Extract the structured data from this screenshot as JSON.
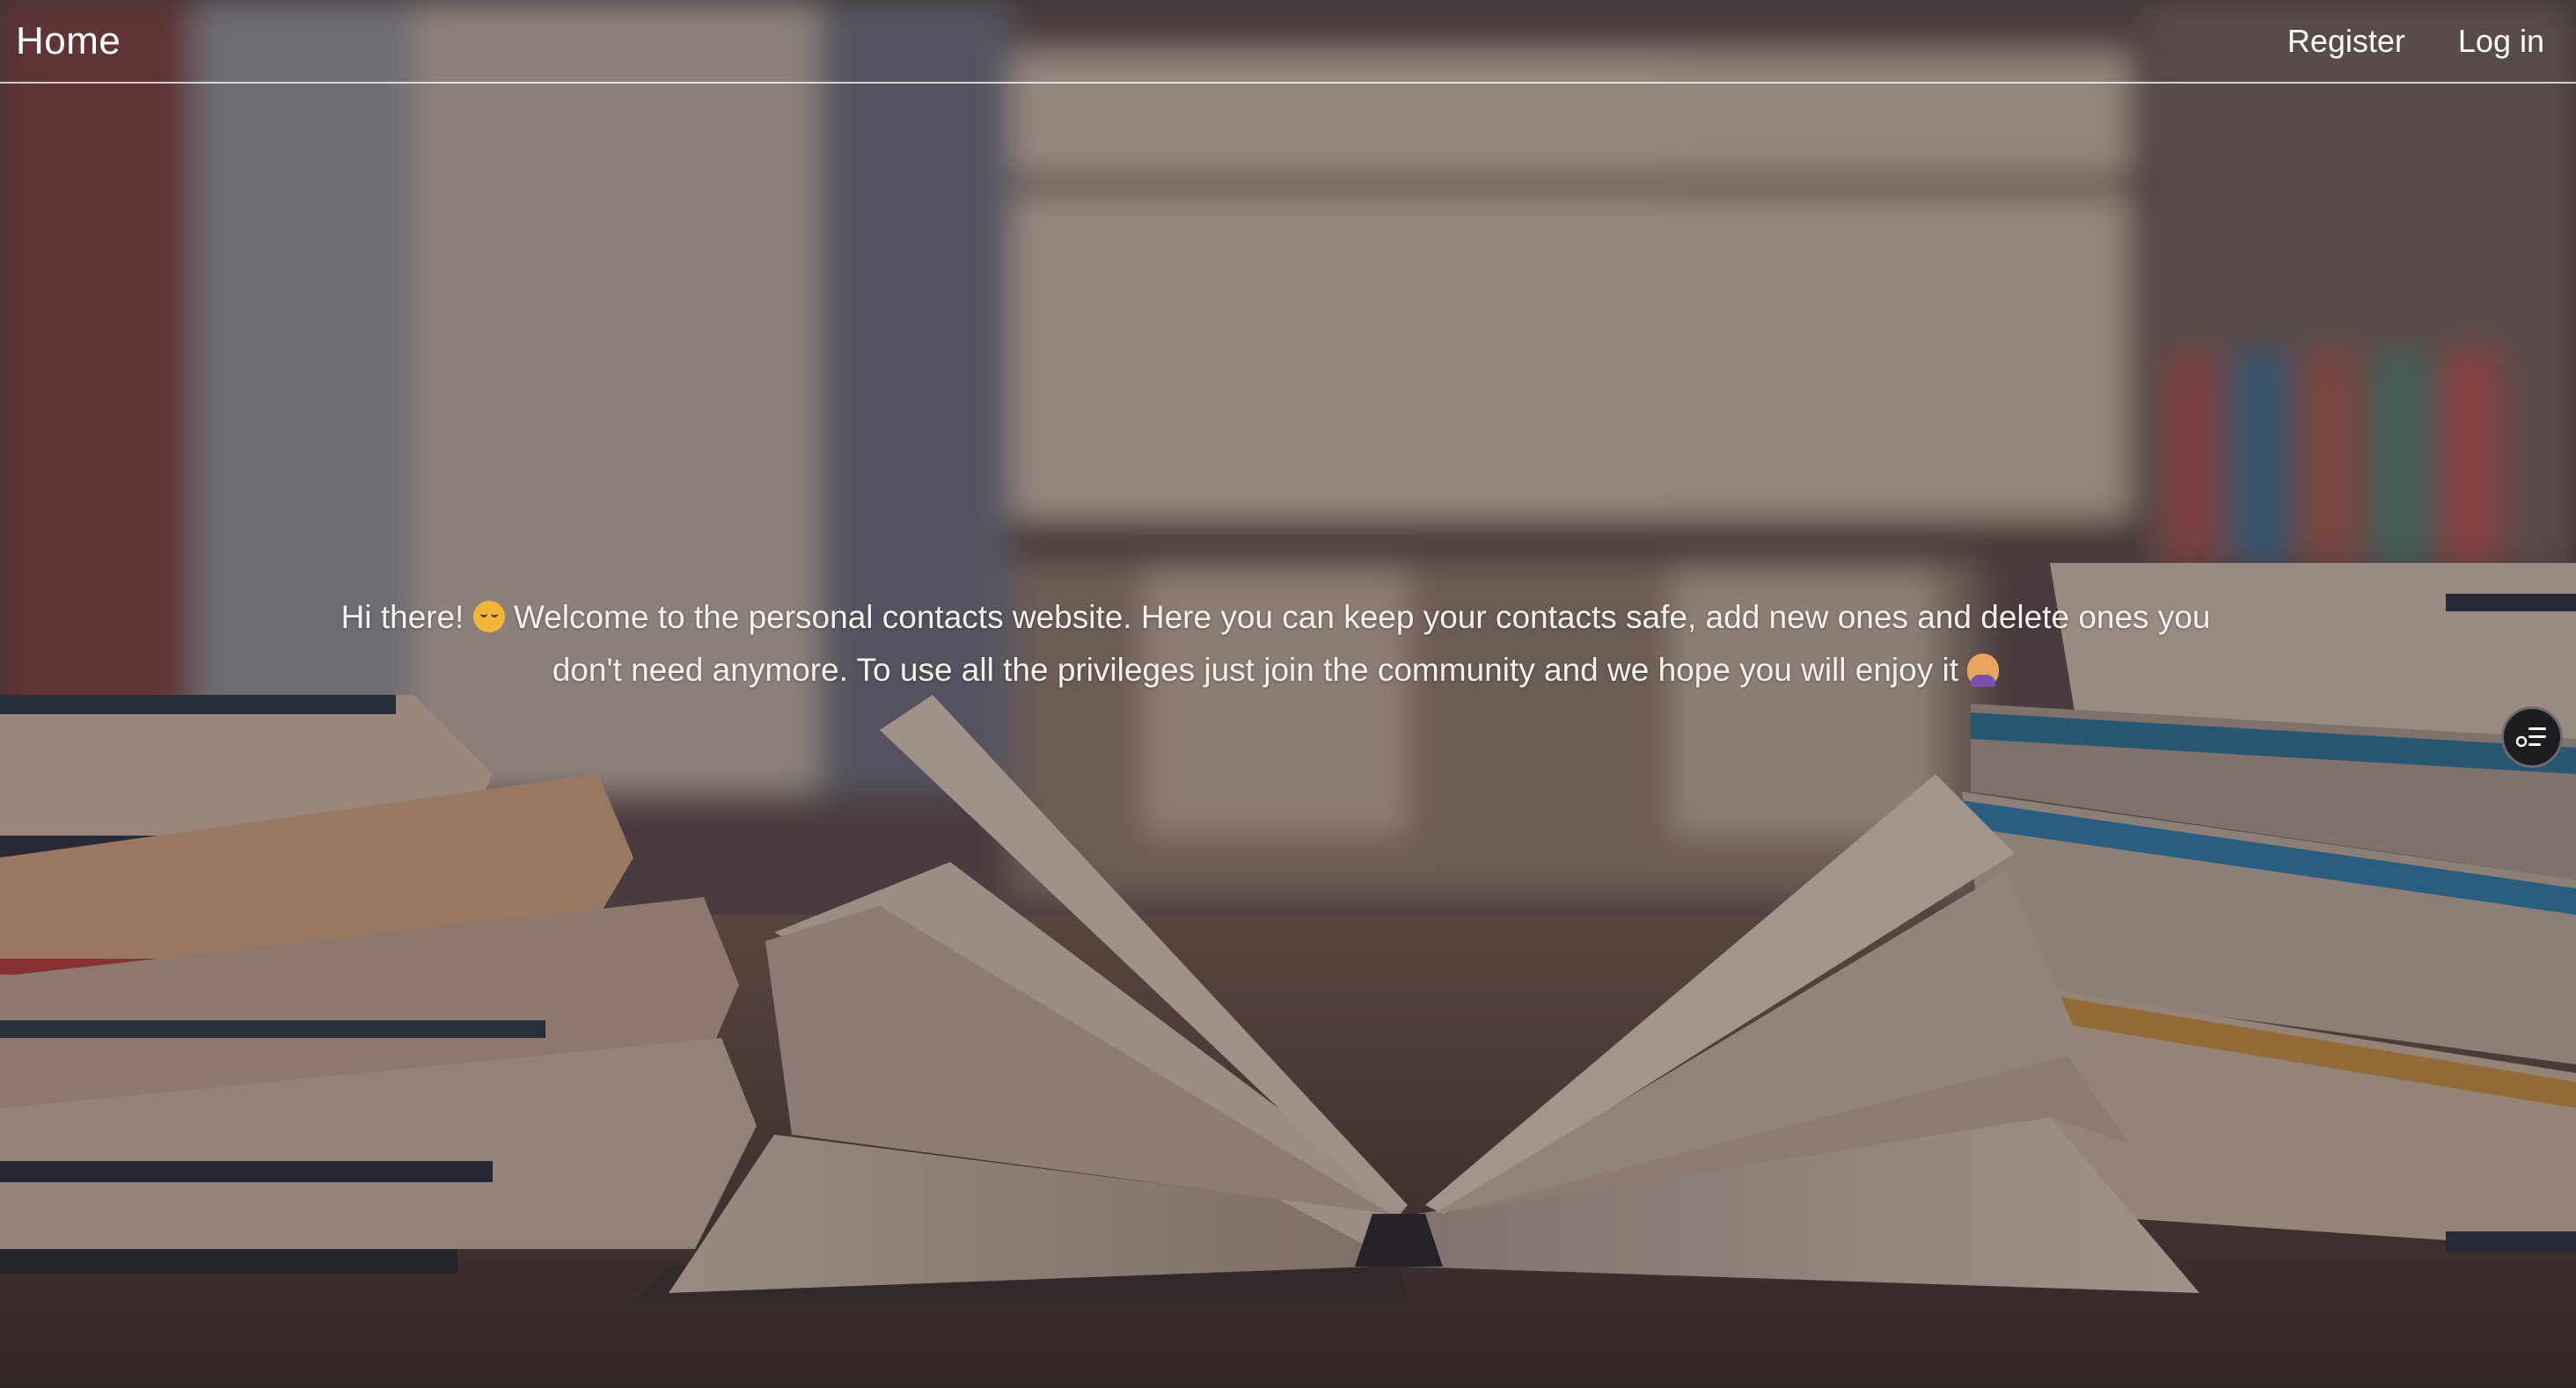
{
  "navbar": {
    "brand": "Home",
    "links": [
      {
        "label": "Register"
      },
      {
        "label": "Log in"
      }
    ]
  },
  "hero": {
    "line1_a": "Hi there!",
    "line1_b": "Welcome to the personal contacts website. Here you can keep your contacts safe, add new ones and delete ones you",
    "line2": "don't need anymore. To use all the privileges just join the community and we hope you will enjoy it",
    "emoji_1": "relieved-face-icon",
    "emoji_2": "person-tipping-hand-icon"
  },
  "widget": {
    "icon": "checklist-icon"
  },
  "colors": {
    "text": "#ffffff",
    "widget_bg": "#1d1d1f"
  }
}
